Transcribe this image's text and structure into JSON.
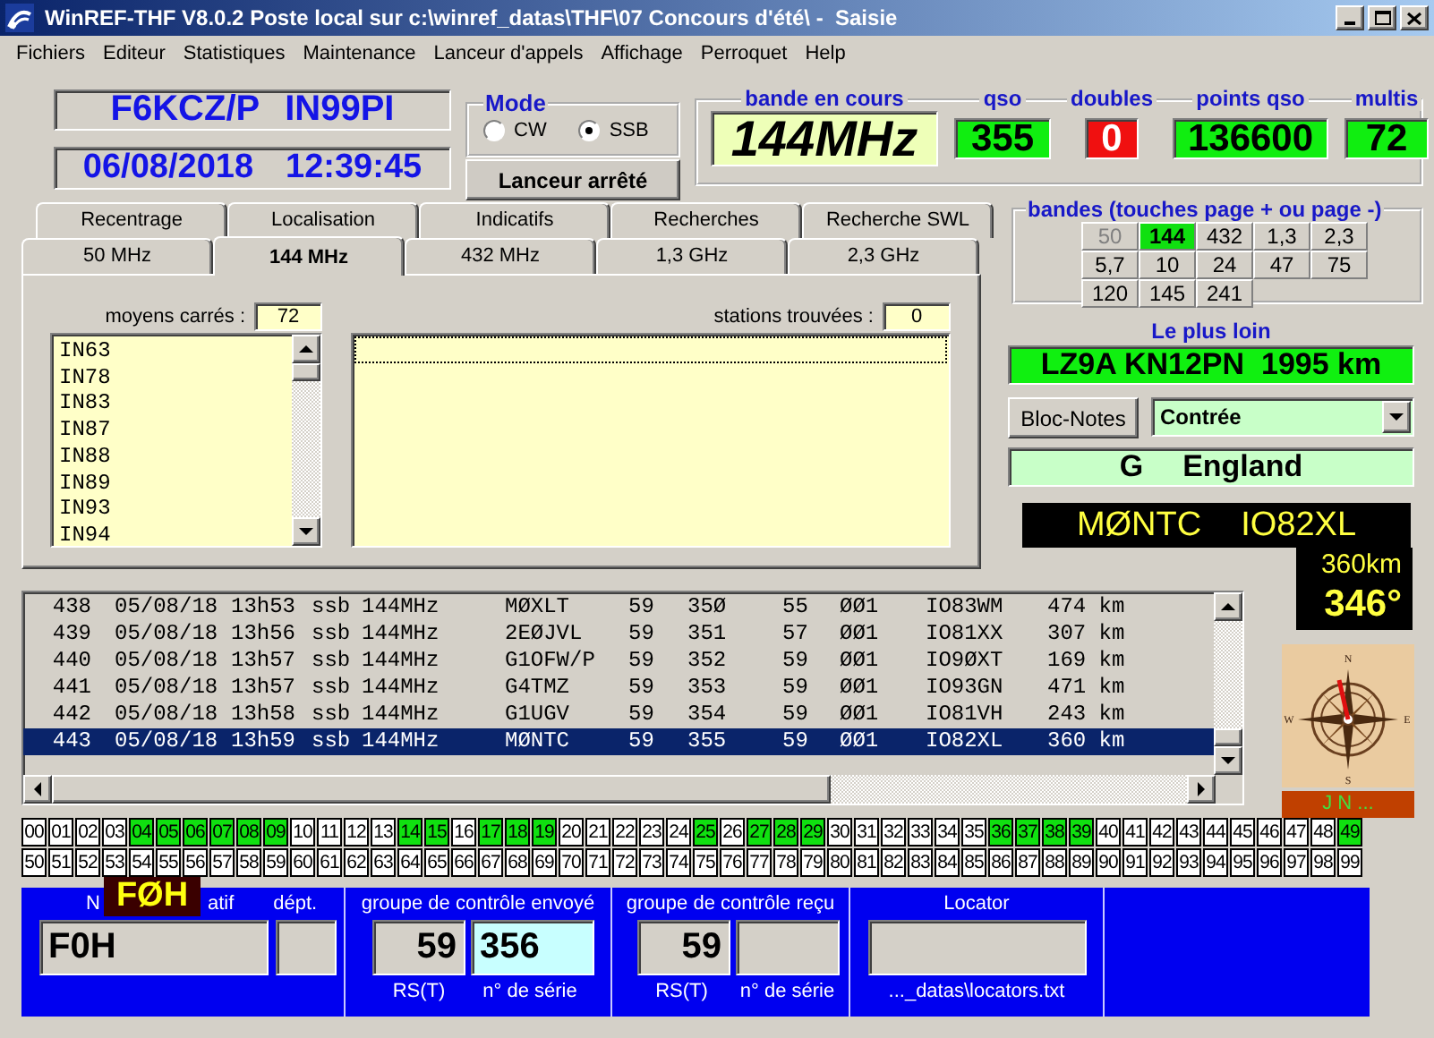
{
  "window": {
    "title": "WinREF-THF V8.0.2 Poste local sur c:\\winref_datas\\THF\\07 Concours d'été\\ -  Saisie"
  },
  "menu": [
    "Fichiers",
    "Editeur",
    "Statistiques",
    "Maintenance",
    "Lanceur d'appels",
    "Affichage",
    "Perroquet",
    "Help"
  ],
  "station": {
    "callsign": "F6KCZ/P",
    "locator": "IN99PI",
    "date": "06/08/2018",
    "time": "12:39:45"
  },
  "mode": {
    "title": "Mode",
    "options": [
      {
        "label": "CW",
        "selected": false
      },
      {
        "label": "SSB",
        "selected": true
      }
    ]
  },
  "launcher_button": "Lanceur arrêté",
  "stats": [
    {
      "label": "bande en cours",
      "value": "144MHz",
      "kind": "band"
    },
    {
      "label": "qso",
      "value": "355",
      "kind": "ok"
    },
    {
      "label": "doubles",
      "value": "0",
      "kind": "alert"
    },
    {
      "label": "points qso",
      "value": "136600",
      "kind": "ok"
    },
    {
      "label": "multis",
      "value": "72",
      "kind": "ok"
    }
  ],
  "tabs": {
    "back_row": [
      {
        "label": "Recentrage",
        "selected": false
      },
      {
        "label": "Localisation",
        "selected": false
      },
      {
        "label": "Indicatifs",
        "selected": false
      },
      {
        "label": "Recherches",
        "selected": false
      },
      {
        "label": "Recherche SWL",
        "selected": false
      }
    ],
    "front_row": [
      {
        "label": "50 MHz",
        "selected": false
      },
      {
        "label": "144 MHz",
        "selected": true
      },
      {
        "label": "432 MHz",
        "selected": false
      },
      {
        "label": "1,3 GHz",
        "selected": false
      },
      {
        "label": "2,3 GHz",
        "selected": false
      }
    ]
  },
  "squares_panel": {
    "label": "moyens carrés :",
    "count": "72",
    "items": [
      "IN63",
      "IN78",
      "IN83",
      "IN87",
      "IN88",
      "IN89",
      "IN93",
      "IN94"
    ]
  },
  "stations_panel": {
    "label": "stations trouvées :",
    "count": "0"
  },
  "bands": {
    "title": "bandes (touches page + ou page -)",
    "items": [
      {
        "label": "50",
        "selected": false,
        "disabled": true
      },
      {
        "label": "144",
        "selected": true,
        "disabled": false
      },
      {
        "label": "432",
        "selected": false,
        "disabled": false
      },
      {
        "label": "1,3",
        "selected": false,
        "disabled": false
      },
      {
        "label": "2,3",
        "selected": false,
        "disabled": false
      },
      {
        "label": "5,7",
        "selected": false,
        "disabled": false
      },
      {
        "label": "10",
        "selected": false,
        "disabled": false
      },
      {
        "label": "24",
        "selected": false,
        "disabled": false
      },
      {
        "label": "47",
        "selected": false,
        "disabled": false
      },
      {
        "label": "75",
        "selected": false,
        "disabled": false
      },
      {
        "label": "120",
        "selected": false,
        "disabled": false
      },
      {
        "label": "145",
        "selected": false,
        "disabled": false
      },
      {
        "label": "241",
        "selected": false,
        "disabled": false
      }
    ]
  },
  "farthest": {
    "title": "Le plus loin",
    "value": "LZ9A KN12PN  1995 km"
  },
  "notes_button": "Bloc-Notes",
  "dropdown": {
    "value": "Contrée"
  },
  "country": {
    "prefix": "G",
    "name": "England"
  },
  "last_qso": {
    "call": "MØNTC",
    "locator": "IO82XL",
    "distance": "360km",
    "bearing": "346°"
  },
  "log": [
    {
      "cells": [
        "438",
        "05/08/18",
        "13h53",
        "ssb",
        "144MHz",
        "MØXLT",
        "59",
        "35Ø",
        "55",
        "ØØ1",
        "IO83WM",
        "474 km"
      ],
      "selected": false
    },
    {
      "cells": [
        "439",
        "05/08/18",
        "13h56",
        "ssb",
        "144MHz",
        "2EØJVL",
        "59",
        "351",
        "57",
        "ØØ1",
        "IO81XX",
        "307 km"
      ],
      "selected": false
    },
    {
      "cells": [
        "440",
        "05/08/18",
        "13h57",
        "ssb",
        "144MHz",
        "G1OFW/P",
        "59",
        "352",
        "59",
        "ØØ1",
        "IO9ØXT",
        "169 km"
      ],
      "selected": false
    },
    {
      "cells": [
        "441",
        "05/08/18",
        "13h57",
        "ssb",
        "144MHz",
        "G4TMZ",
        "59",
        "353",
        "59",
        "ØØ1",
        "IO93GN",
        "471 km"
      ],
      "selected": false
    },
    {
      "cells": [
        "442",
        "05/08/18",
        "13h58",
        "ssb",
        "144MHz",
        "G1UGV",
        "59",
        "354",
        "59",
        "ØØ1",
        "IO81VH",
        "243 km"
      ],
      "selected": false
    },
    {
      "cells": [
        "443",
        "05/08/18",
        "13h59",
        "ssb",
        "144MHz",
        "MØNTC",
        "59",
        "355",
        "59",
        "ØØ1",
        "IO82XL",
        "360 km"
      ],
      "selected": true
    }
  ],
  "compass": {
    "north": "N",
    "east": "E",
    "south": "S",
    "west": "W",
    "caption": "J N ..."
  },
  "squares": [
    {
      "label": "00",
      "on": false
    },
    {
      "label": "01",
      "on": false
    },
    {
      "label": "02",
      "on": false
    },
    {
      "label": "03",
      "on": false
    },
    {
      "label": "04",
      "on": true
    },
    {
      "label": "05",
      "on": true
    },
    {
      "label": "06",
      "on": true
    },
    {
      "label": "07",
      "on": true
    },
    {
      "label": "08",
      "on": true
    },
    {
      "label": "09",
      "on": true
    },
    {
      "label": "10",
      "on": false
    },
    {
      "label": "11",
      "on": false
    },
    {
      "label": "12",
      "on": false
    },
    {
      "label": "13",
      "on": false
    },
    {
      "label": "14",
      "on": true
    },
    {
      "label": "15",
      "on": true
    },
    {
      "label": "16",
      "on": false
    },
    {
      "label": "17",
      "on": true
    },
    {
      "label": "18",
      "on": true
    },
    {
      "label": "19",
      "on": true
    },
    {
      "label": "20",
      "on": false
    },
    {
      "label": "21",
      "on": false
    },
    {
      "label": "22",
      "on": false
    },
    {
      "label": "23",
      "on": false
    },
    {
      "label": "24",
      "on": false
    },
    {
      "label": "25",
      "on": true
    },
    {
      "label": "26",
      "on": false
    },
    {
      "label": "27",
      "on": true
    },
    {
      "label": "28",
      "on": true
    },
    {
      "label": "29",
      "on": true
    },
    {
      "label": "30",
      "on": false
    },
    {
      "label": "31",
      "on": false
    },
    {
      "label": "32",
      "on": false
    },
    {
      "label": "33",
      "on": false
    },
    {
      "label": "34",
      "on": false
    },
    {
      "label": "35",
      "on": false
    },
    {
      "label": "36",
      "on": true
    },
    {
      "label": "37",
      "on": true
    },
    {
      "label": "38",
      "on": true
    },
    {
      "label": "39",
      "on": true
    },
    {
      "label": "40",
      "on": false
    },
    {
      "label": "41",
      "on": false
    },
    {
      "label": "42",
      "on": false
    },
    {
      "label": "43",
      "on": false
    },
    {
      "label": "44",
      "on": false
    },
    {
      "label": "45",
      "on": false
    },
    {
      "label": "46",
      "on": false
    },
    {
      "label": "47",
      "on": false
    },
    {
      "label": "48",
      "on": false
    },
    {
      "label": "49",
      "on": true
    },
    {
      "label": "50",
      "on": false
    },
    {
      "label": "51",
      "on": false
    },
    {
      "label": "52",
      "on": false
    },
    {
      "label": "53",
      "on": false
    },
    {
      "label": "54",
      "on": false
    },
    {
      "label": "55",
      "on": false
    },
    {
      "label": "56",
      "on": false
    },
    {
      "label": "57",
      "on": false
    },
    {
      "label": "58",
      "on": false
    },
    {
      "label": "59",
      "on": false
    },
    {
      "label": "60",
      "on": false
    },
    {
      "label": "61",
      "on": false
    },
    {
      "label": "62",
      "on": false
    },
    {
      "label": "63",
      "on": false
    },
    {
      "label": "64",
      "on": false
    },
    {
      "label": "65",
      "on": false
    },
    {
      "label": "66",
      "on": false
    },
    {
      "label": "67",
      "on": false
    },
    {
      "label": "68",
      "on": false
    },
    {
      "label": "69",
      "on": false
    },
    {
      "label": "70",
      "on": false
    },
    {
      "label": "71",
      "on": false
    },
    {
      "label": "72",
      "on": false
    },
    {
      "label": "73",
      "on": false
    },
    {
      "label": "74",
      "on": false
    },
    {
      "label": "75",
      "on": false
    },
    {
      "label": "76",
      "on": false
    },
    {
      "label": "77",
      "on": false
    },
    {
      "label": "78",
      "on": false
    },
    {
      "label": "79",
      "on": false
    },
    {
      "label": "80",
      "on": false
    },
    {
      "label": "81",
      "on": false
    },
    {
      "label": "82",
      "on": false
    },
    {
      "label": "83",
      "on": false
    },
    {
      "label": "84",
      "on": false
    },
    {
      "label": "85",
      "on": false
    },
    {
      "label": "86",
      "on": false
    },
    {
      "label": "87",
      "on": false
    },
    {
      "label": "88",
      "on": false
    },
    {
      "label": "89",
      "on": false
    },
    {
      "label": "90",
      "on": false
    },
    {
      "label": "91",
      "on": false
    },
    {
      "label": "92",
      "on": false
    },
    {
      "label": "93",
      "on": false
    },
    {
      "label": "94",
      "on": false
    },
    {
      "label": "95",
      "on": false
    },
    {
      "label": "96",
      "on": false
    },
    {
      "label": "97",
      "on": false
    },
    {
      "label": "98",
      "on": false
    },
    {
      "label": "99",
      "on": false
    }
  ],
  "entry": {
    "tooltip": "FØH",
    "call_label_start": "N",
    "call_label_end": "atif",
    "call_value": "F0H",
    "dept_label": "dépt.",
    "sent": {
      "title": "groupe de contrôle envoyé",
      "rst": "59",
      "serial": "356",
      "rst_label": "RS(T)",
      "serial_label": "n° de série"
    },
    "received": {
      "title": "groupe de contrôle reçu",
      "rst": "59",
      "rst_label": "RS(T)",
      "serial_label": "n° de série"
    },
    "locator": {
      "title": "Locator",
      "file": "..._datas\\locators.txt"
    }
  }
}
